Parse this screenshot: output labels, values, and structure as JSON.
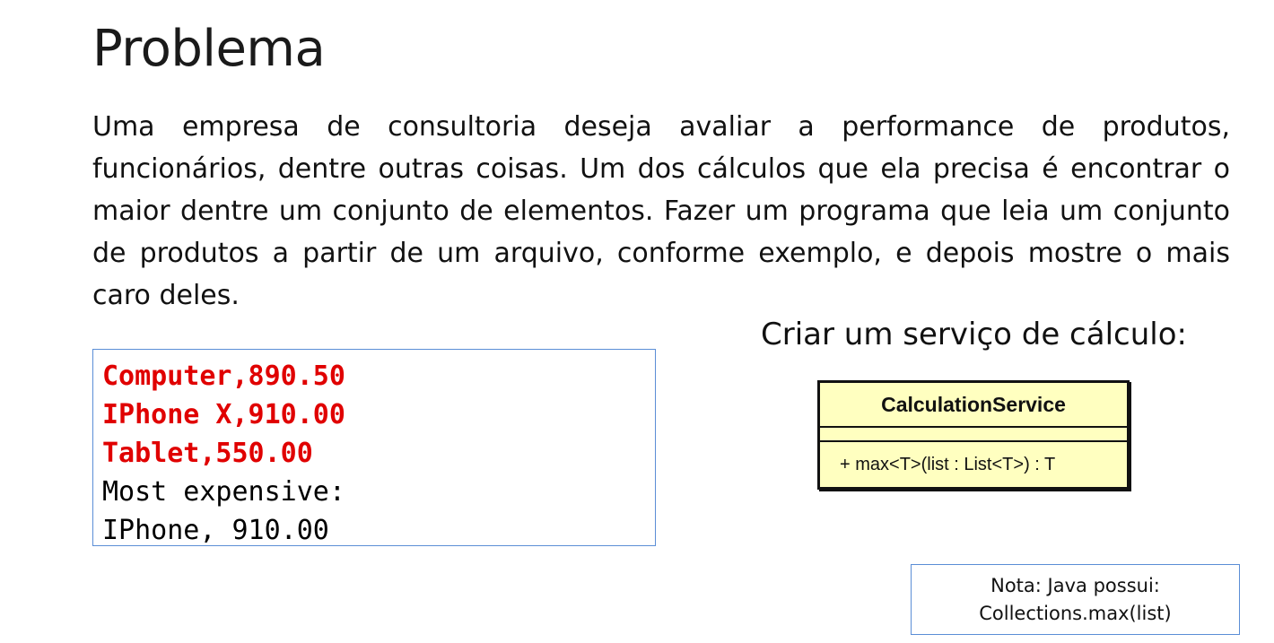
{
  "slide": {
    "title": "Problema",
    "paragraph": "Uma empresa de consultoria deseja avaliar a performance de produtos, funcionários, dentre outras coisas. Um dos cálculos que ela precisa é encontrar o maior dentre um conjunto de elementos. Fazer um programa que leia um conjunto de produtos a partir de um arquivo, conforme exemplo, e depois mostre o mais caro deles."
  },
  "console": {
    "input_lines": [
      "Computer,890.50",
      "IPhone X,910.00",
      "Tablet,550.00"
    ],
    "output_lines": [
      "Most expensive:",
      "IPhone, 910.00"
    ],
    "input_color": "#e00000"
  },
  "service": {
    "heading": "Criar um serviço de cálculo:",
    "class_name": "CalculationService",
    "operation": "+ max<T>(list : List<T>) : T",
    "fill_color": "#ffffc0"
  },
  "note": {
    "line1": "Nota: Java possui:",
    "line2": "Collections.max(list)"
  }
}
